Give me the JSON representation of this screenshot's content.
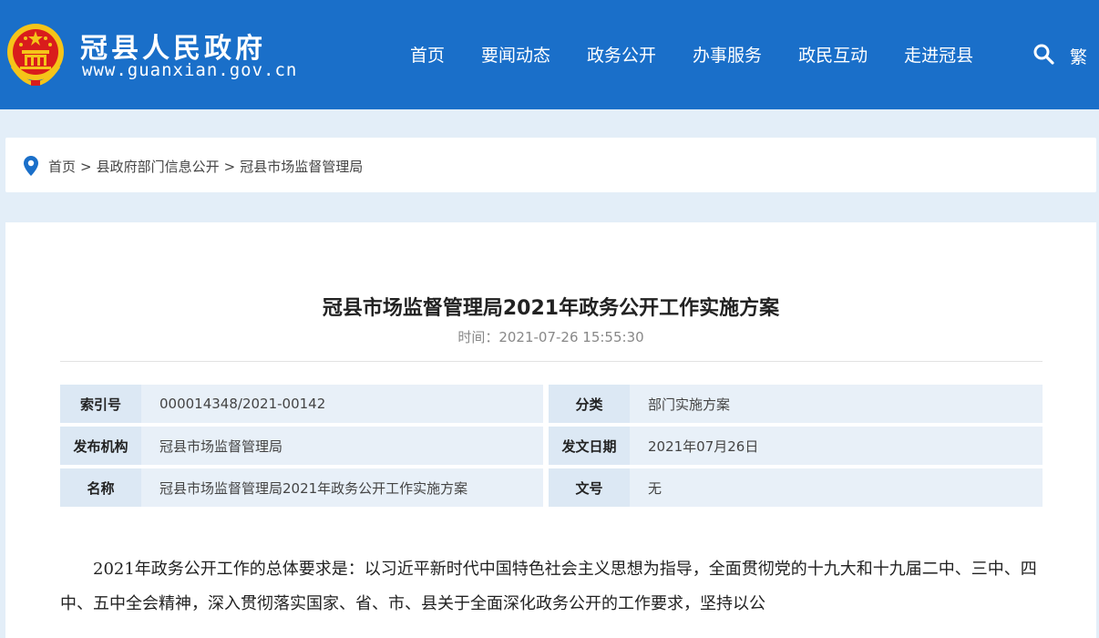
{
  "header": {
    "title": "冠县人民政府",
    "url": "www.guanxian.gov.cn",
    "nav": [
      "首页",
      "要闻动态",
      "政务公开",
      "办事服务",
      "政民互动",
      "走进冠县"
    ],
    "lang_toggle": "繁",
    "brand_color": "#1a6fc9"
  },
  "breadcrumb": {
    "items": [
      "首页",
      "县政府部门信息公开",
      "冠县市场监督管理局"
    ],
    "separator": ">"
  },
  "article": {
    "title": "冠县市场监督管理局2021年政务公开工作实施方案",
    "time_label": "时间：",
    "time_value": "2021-07-26 15:55:30",
    "meta": {
      "index_label": "索引号",
      "index_value": "000014348/2021-00142",
      "category_label": "分类",
      "category_value": "部门实施方案",
      "publisher_label": "发布机构",
      "publisher_value": "冠县市场监督管理局",
      "date_label": "发文日期",
      "date_value": "2021年07月26日",
      "name_label": "名称",
      "name_value": "冠县市场监督管理局2021年政务公开工作实施方案",
      "docno_label": "文号",
      "docno_value": "无"
    },
    "body": "2021年政务公开工作的总体要求是：以习近平新时代中国特色社会主义思想为指导，全面贯彻党的十九大和十九届二中、三中、四中、五中全会精神，深入贯彻落实国家、省、市、县关于全面深化政务公开的工作要求，坚持以公"
  }
}
